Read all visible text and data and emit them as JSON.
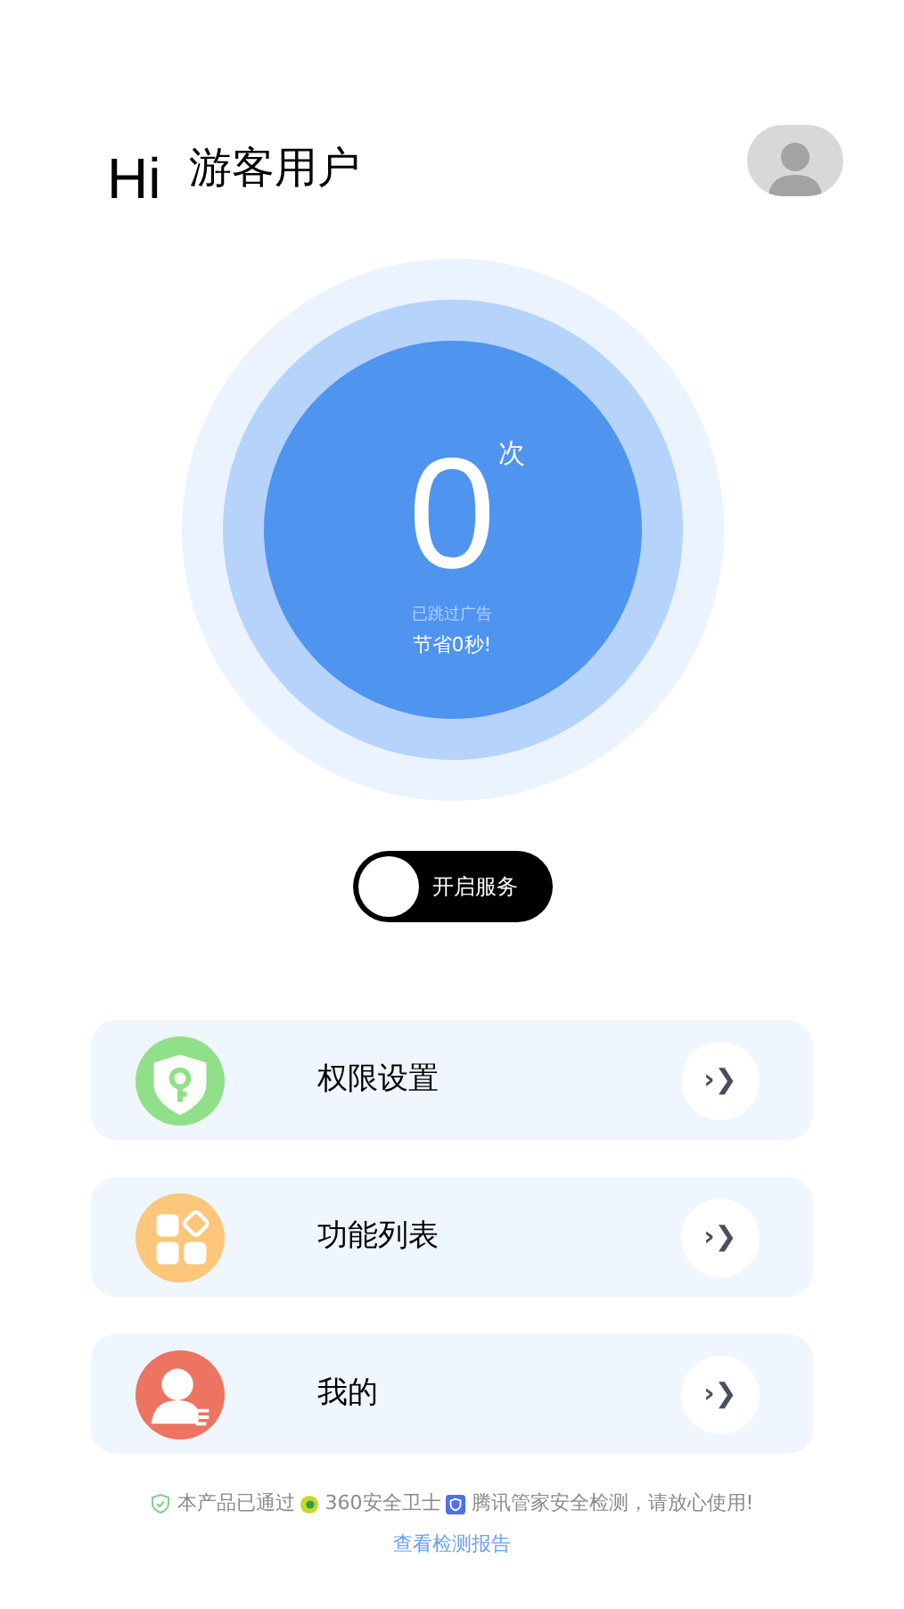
{
  "header": {
    "greeting": "Hi",
    "username": "游客用户"
  },
  "counter": {
    "count": "0",
    "unit": "次",
    "caption": "已跳过广告",
    "saved": "节省0秒!"
  },
  "service_toggle": {
    "label": "开启服务",
    "on": false
  },
  "menu": [
    {
      "kind": "permission",
      "label": "权限设置",
      "arrow": "›❯"
    },
    {
      "kind": "features",
      "label": "功能列表",
      "arrow": "›❯"
    },
    {
      "kind": "profile",
      "label": "我的",
      "arrow": "›❯"
    }
  ],
  "footer": {
    "parts": [
      "本产品已通过",
      "360安全卫士",
      "腾讯管家安全检测，请放心使用!"
    ],
    "link": "查看检测报告"
  }
}
